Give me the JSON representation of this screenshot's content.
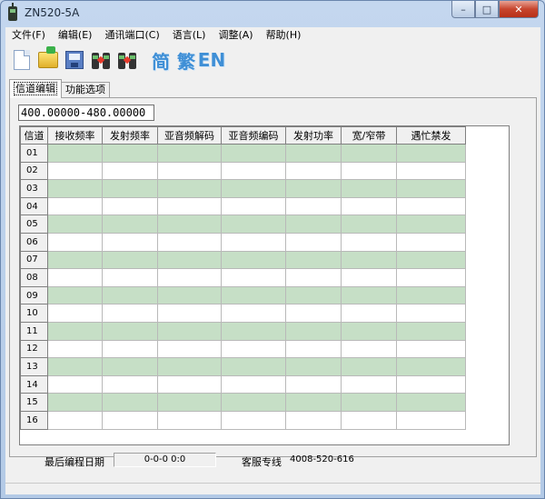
{
  "window": {
    "title": "ZN520-5A"
  },
  "menu": [
    "文件(F)",
    "编辑(E)",
    "通讯端口(C)",
    "语言(L)",
    "调整(A)",
    "帮助(H)"
  ],
  "toolbar": {
    "icons": [
      "new-file-icon",
      "open-folder-icon",
      "save-disk-icon",
      "read-radio-icon",
      "write-radio-icon"
    ],
    "lang_simplified": "简",
    "lang_traditional": "繁",
    "lang_english": "EN"
  },
  "tabs": [
    "信道编辑",
    "功能选项"
  ],
  "frequency_range": "400.00000-480.00000",
  "table": {
    "headers": [
      "信道",
      "接收频率",
      "发射频率",
      "亚音频解码",
      "亚音频编码",
      "发射功率",
      "宽/窄带",
      "遇忙禁发"
    ],
    "channels": [
      "01",
      "02",
      "03",
      "04",
      "05",
      "06",
      "07",
      "08",
      "09",
      "10",
      "11",
      "12",
      "13",
      "14",
      "15",
      "16"
    ]
  },
  "footer": {
    "last_program_label": "最后编程日期",
    "last_program_value": "0-0-0   0:0",
    "service_label": "客服专线",
    "service_phone": "4008-520-616"
  },
  "colors": {
    "odd_row": "#c6dfc6",
    "even_row": "#ffffff",
    "title_gradient": "#c4d7ef"
  }
}
